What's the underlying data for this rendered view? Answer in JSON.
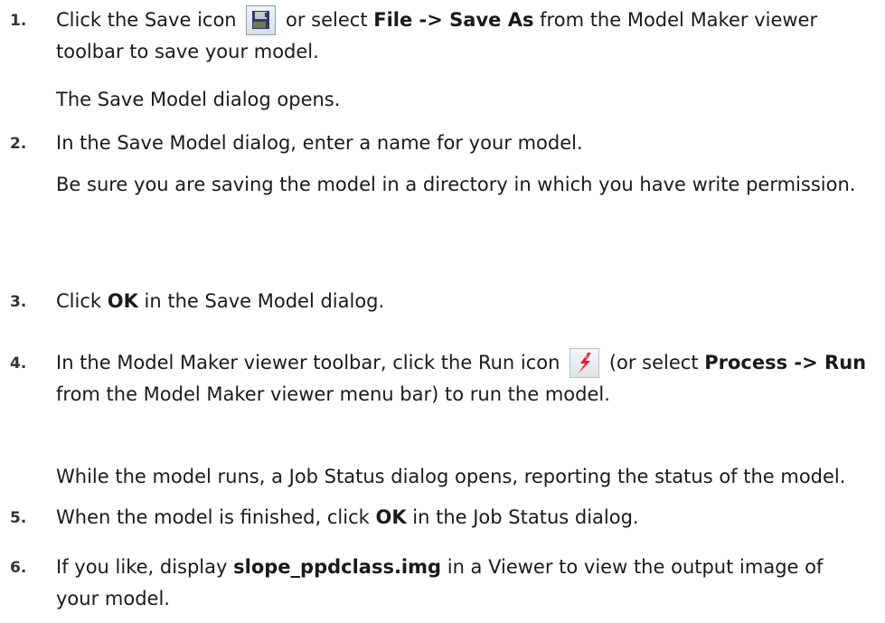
{
  "steps": [
    {
      "number": "1.",
      "lines": [
        {
          "parts": [
            "Click the Save icon",
            "or select",
            "File -> Save As",
            "from the Model Maker viewer toolbar to save your model."
          ]
        },
        {
          "text": "The Save Model dialog opens."
        }
      ],
      "icon": "save-icon"
    },
    {
      "number": "2.",
      "lines": [
        {
          "text": "In the Save Model dialog, enter a name for your model."
        },
        {
          "text": "Be sure you are saving the model in a directory in which you have write permission."
        }
      ]
    },
    {
      "number": "3.",
      "lines": [
        {
          "parts": [
            "Click",
            "OK",
            "in the Save Model dialog."
          ]
        }
      ]
    },
    {
      "number": "4.",
      "lines": [
        {
          "parts": [
            "In the Model Maker viewer toolbar, click the Run icon",
            "(or select",
            "Process -> Run",
            "from the Model Maker viewer menu bar) to run the model."
          ]
        },
        {
          "text": "While the model runs, a Job Status dialog opens, reporting the status of the model."
        }
      ],
      "icon": "run-icon"
    },
    {
      "number": "5.",
      "lines": [
        {
          "parts": [
            "When the model is finished, click",
            "OK",
            "in the Job Status dialog."
          ]
        }
      ]
    },
    {
      "number": "6.",
      "lines": [
        {
          "parts": [
            "If you like, display",
            "slope_ppdclass.img",
            "in a Viewer to view the output image of your model."
          ]
        }
      ]
    }
  ]
}
